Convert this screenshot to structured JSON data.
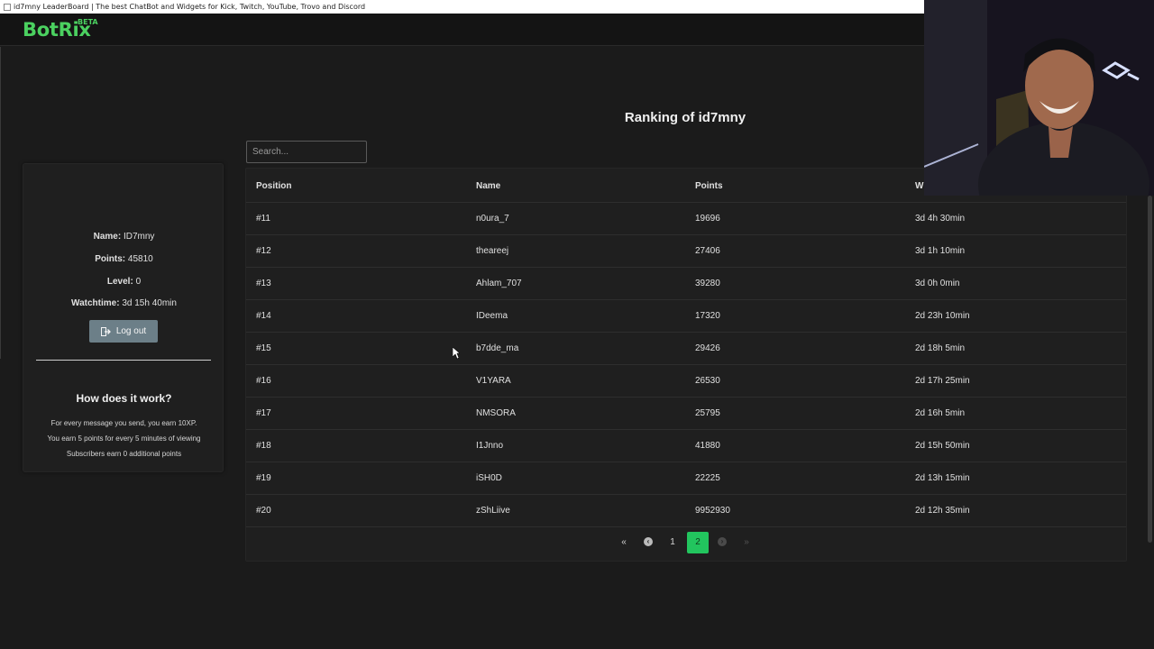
{
  "window": {
    "title": "id7mny LeaderBoard | The best ChatBot and Widgets for Kick, Twitch, YouTube, Trovo and Discord"
  },
  "navbar": {
    "logo": "BotRix",
    "badge": "BETA",
    "brand_color": "#4bd160"
  },
  "main": {
    "title": "Ranking of id7mny",
    "search": {
      "placeholder": "Search...",
      "value": ""
    }
  },
  "profile": {
    "name_label": "Name:",
    "name": "ID7mny",
    "points_label": "Points:",
    "points": "45810",
    "level_label": "Level:",
    "level": "0",
    "watchtime_label": "Watchtime:",
    "watchtime": "3d 15h 40min",
    "logout": "Log out",
    "how_title": "How does it work?",
    "how_lines": [
      "For every message you send, you earn 10XP.",
      "You earn 5 points for every 5 minutes of viewing",
      "Subscribers earn 0 additional points"
    ]
  },
  "table": {
    "headers": [
      "Position",
      "Name",
      "Points",
      "W"
    ],
    "rows": [
      {
        "position": "#11",
        "name": "n0ura_7",
        "points": "19696",
        "watchtime": "3d 4h 30min"
      },
      {
        "position": "#12",
        "name": "theareej",
        "points": "27406",
        "watchtime": "3d 1h 10min"
      },
      {
        "position": "#13",
        "name": "Ahlam_707",
        "points": "39280",
        "watchtime": "3d 0h 0min"
      },
      {
        "position": "#14",
        "name": "IDeema",
        "points": "17320",
        "watchtime": "2d 23h 10min"
      },
      {
        "position": "#15",
        "name": "b7dde_ma",
        "points": "29426",
        "watchtime": "2d 18h 5min"
      },
      {
        "position": "#16",
        "name": "V1YARA",
        "points": "26530",
        "watchtime": "2d 17h 25min"
      },
      {
        "position": "#17",
        "name": "NMSORA",
        "points": "25795",
        "watchtime": "2d 16h 5min"
      },
      {
        "position": "#18",
        "name": "I1Jnno",
        "points": "41880",
        "watchtime": "2d 15h 50min"
      },
      {
        "position": "#19",
        "name": "iSH0D",
        "points": "22225",
        "watchtime": "2d 13h 15min"
      },
      {
        "position": "#20",
        "name": "zShLiive",
        "points": "9952930",
        "watchtime": "2d 12h 35min"
      }
    ]
  },
  "pagination": {
    "first": "«",
    "prev": "‹",
    "pages": [
      "1",
      "2"
    ],
    "current": "2",
    "next": "›",
    "last": "»",
    "active_color": "#22c55e"
  }
}
